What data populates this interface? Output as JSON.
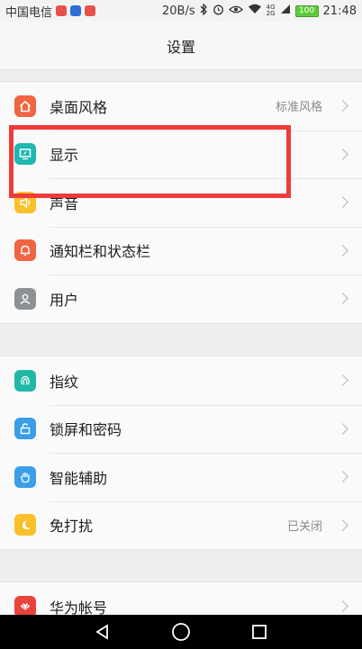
{
  "status_bar": {
    "carrier": "中国电信",
    "speed": "20B/s",
    "network": "4G",
    "network2": "2G",
    "battery": "100",
    "time": "21:48"
  },
  "header": {
    "title": "设置"
  },
  "groups": [
    {
      "items": [
        {
          "label": "桌面风格",
          "value": "标准风格",
          "icon": "home-icon",
          "color": "#f06543"
        },
        {
          "label": "显示",
          "value": "",
          "icon": "display-icon",
          "color": "#1fb7b0"
        },
        {
          "label": "声音",
          "value": "",
          "icon": "speaker-icon",
          "color": "#f9c02a"
        },
        {
          "label": "通知栏和状态栏",
          "value": "",
          "icon": "bell-icon",
          "color": "#f06543"
        },
        {
          "label": "用户",
          "value": "",
          "icon": "user-icon",
          "color": "#8d9094"
        }
      ]
    },
    {
      "items": [
        {
          "label": "指纹",
          "value": "",
          "icon": "fingerprint-icon",
          "color": "#21b8a8"
        },
        {
          "label": "锁屏和密码",
          "value": "",
          "icon": "lock-icon",
          "color": "#3a9ee9"
        },
        {
          "label": "智能辅助",
          "value": "",
          "icon": "hand-icon",
          "color": "#3a9ee9"
        },
        {
          "label": "免打扰",
          "value": "已关闭",
          "icon": "moon-icon",
          "color": "#f9c02a"
        }
      ]
    },
    {
      "items": [
        {
          "label": "华为帐号",
          "value": "",
          "icon": "huawei-icon",
          "color": "#e8443a"
        }
      ]
    }
  ],
  "colors": {
    "highlight": "#ef3b3b",
    "background": "#efeff0"
  }
}
